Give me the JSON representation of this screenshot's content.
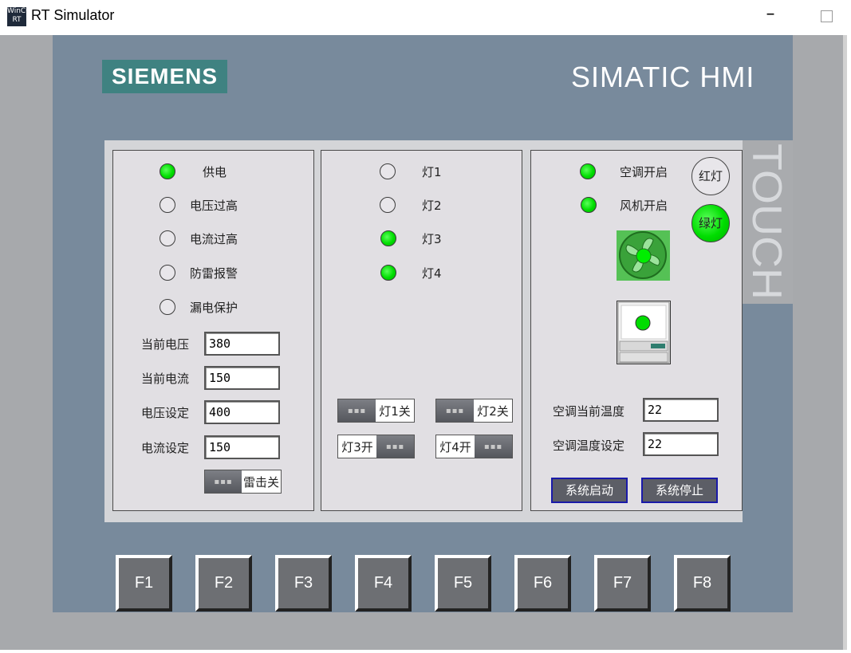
{
  "window": {
    "title": "RT Simulator",
    "icon_text": "WinCC RT",
    "icon": "wincc-app-icon"
  },
  "device": {
    "brand": "SIEMENS",
    "model": "SIMATIC HMI",
    "touch_label": "TOUCH"
  },
  "left_panel": {
    "indicators": [
      {
        "label": "供电",
        "on": true
      },
      {
        "label": "电压过高",
        "on": false
      },
      {
        "label": "电流过高",
        "on": false
      },
      {
        "label": "防雷报警",
        "on": false
      },
      {
        "label": "漏电保护",
        "on": false
      }
    ],
    "fields": [
      {
        "label": "当前电压",
        "value": "380"
      },
      {
        "label": "当前电流",
        "value": "150"
      },
      {
        "label": "电压设定",
        "value": "400"
      },
      {
        "label": "电流设定",
        "value": "150"
      }
    ],
    "lightning_toggle": {
      "label": "雷击关"
    }
  },
  "middle_panel": {
    "lamps": [
      {
        "label": "灯1",
        "on": false
      },
      {
        "label": "灯2",
        "on": false
      },
      {
        "label": "灯3",
        "on": true
      },
      {
        "label": "灯4",
        "on": true
      }
    ],
    "toggles": [
      {
        "label": "灯1关"
      },
      {
        "label": "灯2关"
      },
      {
        "label": "灯3开"
      },
      {
        "label": "灯4开"
      }
    ]
  },
  "right_panel": {
    "indicators": [
      {
        "label": "空调开启",
        "on": true
      },
      {
        "label": "风机开启",
        "on": true
      }
    ],
    "red_light_button": "红灯",
    "green_light_button": "绿灯",
    "fields": [
      {
        "label": "空调当前温度",
        "value": "22"
      },
      {
        "label": "空调温度设定",
        "value": "22"
      }
    ],
    "start_button": "系统启动",
    "stop_button": "系统停止"
  },
  "function_keys": [
    "F1",
    "F2",
    "F3",
    "F4",
    "F5",
    "F6",
    "F7",
    "F8"
  ],
  "colors": {
    "led_on": "#00dd00",
    "bezel": "#788a9c",
    "siemens_teal": "#3f8281",
    "button_border": "#1a1aa8"
  }
}
